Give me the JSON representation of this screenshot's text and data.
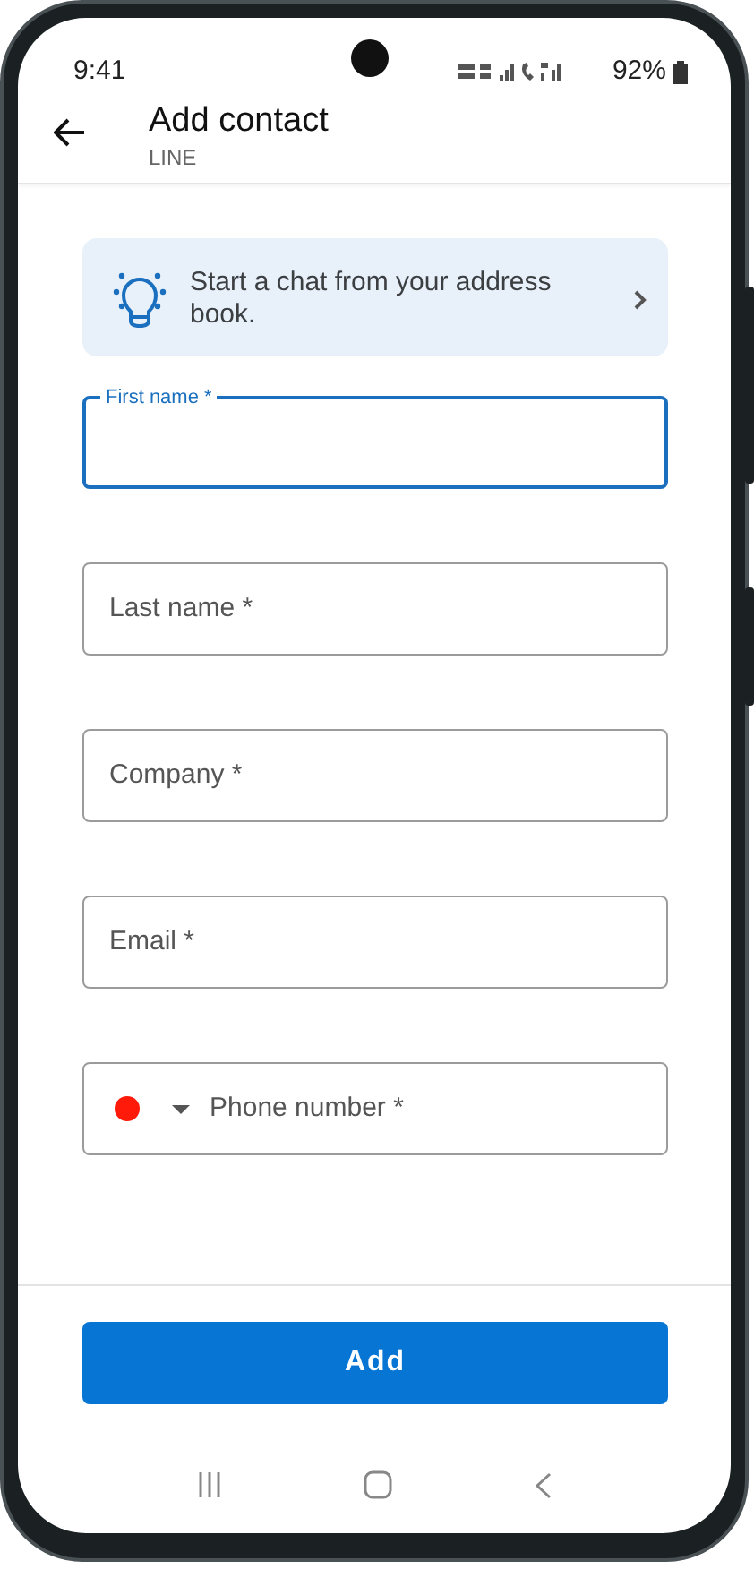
{
  "status_bar": {
    "time": "9:41",
    "battery": "92%"
  },
  "header": {
    "title": "Add contact",
    "subtitle": "LINE"
  },
  "banner": {
    "text": "Start a chat from your address book."
  },
  "fields": [
    {
      "kind": "text",
      "label": "First name *",
      "focused": true
    },
    {
      "kind": "text",
      "label": "Last name *",
      "focused": false
    },
    {
      "kind": "text",
      "label": "Company *",
      "focused": false
    },
    {
      "kind": "text",
      "label": "Email *",
      "focused": false
    },
    {
      "kind": "phone",
      "label": "Phone number *",
      "focused": false,
      "color": "#ff1a0a"
    }
  ],
  "submit": {
    "label": "Add"
  }
}
